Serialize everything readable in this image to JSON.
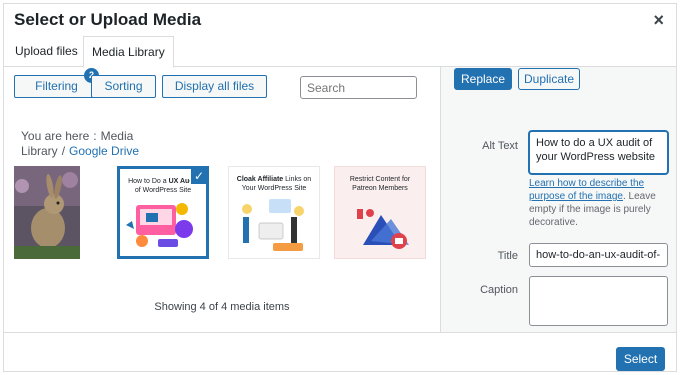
{
  "modal": {
    "title": "Select or Upload Media",
    "close_symbol": "×"
  },
  "tabs": [
    {
      "label": "Upload files"
    },
    {
      "label": "Media Library"
    }
  ],
  "toolbar": {
    "filtering_label": "Filtering",
    "filtering_badge": "2",
    "sorting_label": "Sorting",
    "display_all_label": "Display all files",
    "search_placeholder": "Search"
  },
  "breadcrumb": {
    "prefix": "You are here",
    "separator1": ":",
    "item1": "Media Library",
    "separator2": "/",
    "item2": "Google Drive"
  },
  "media": {
    "items": [
      {
        "name": "rabbit-photo",
        "title": ""
      },
      {
        "name": "ux-audit",
        "title_prefix": "How to Do a ",
        "title_bold": "UX Audit",
        "title_suffix": " of WordPress Site",
        "selected": true
      },
      {
        "name": "cloak-affiliate",
        "title_bold": "Cloak Affiliate",
        "title_suffix": " Links on Your WordPress Site"
      },
      {
        "name": "restrict-content",
        "title_prefix": "Restrict Content for Patreon Members"
      }
    ],
    "count_text": "Showing 4 of 4 media items"
  },
  "sidebar": {
    "replace_label": "Replace",
    "duplicate_label": "Duplicate",
    "alt_text_label": "Alt Text",
    "alt_text_value": "How to do a UX audit of your WordPress website",
    "help_link": "Learn how to describe the purpose of the image",
    "help_text": ". Leave empty if the image is purely decorative.",
    "title_label": "Title",
    "title_value": "how-to-do-an-ux-audit-of-",
    "caption_label": "Caption",
    "caption_value": ""
  },
  "footer": {
    "select_label": "Select"
  },
  "colors": {
    "accent": "#2271b1",
    "border": "#dcdcde",
    "sidebar_bg": "#f6f7f7"
  }
}
